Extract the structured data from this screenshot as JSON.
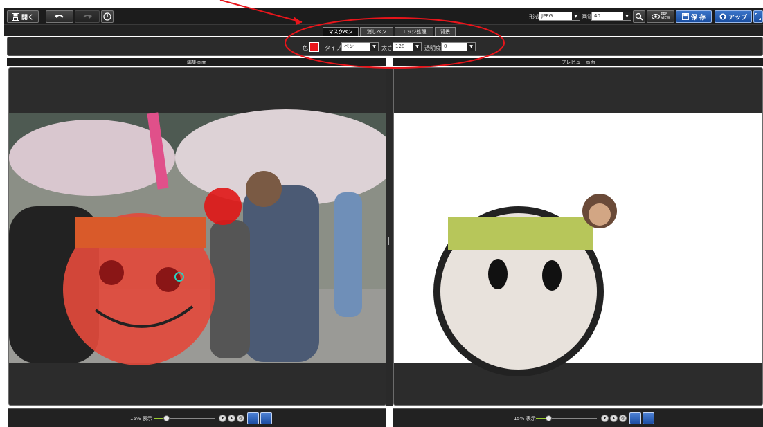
{
  "toolbar": {
    "open_label": "開く",
    "format_label": "形式",
    "format_value": "JPEG",
    "quality_label": "画質",
    "quality_value": "40",
    "preview_label_top": "PRE",
    "preview_label_bottom": "VIEW",
    "save_label": "保 存",
    "upload_label": "アップ"
  },
  "tabs": [
    {
      "label": "マスクペン",
      "active": true
    },
    {
      "label": "消しペン",
      "active": false
    },
    {
      "label": "エッジ処理",
      "active": false
    },
    {
      "label": "背景",
      "active": false
    }
  ],
  "options": {
    "color_label": "色",
    "color_value": "#e8151b",
    "type_label": "タイプ",
    "type_value": "ペン",
    "thickness_label": "太さ",
    "thickness_value": "128",
    "opacity_label": "透明度",
    "opacity_value": "0"
  },
  "panes": {
    "edit_title": "編集画面",
    "preview_title": "プレビュー画面"
  },
  "bottom": {
    "left_zoom_label": "15% 表示",
    "right_zoom_label": "15% 表示",
    "zoom_fraction": 0.2
  },
  "colors": {
    "accent_blue": "#1a4ea0",
    "annotation_red": "#e8151b"
  },
  "icons": [
    "save-icon",
    "undo-icon",
    "redo-icon",
    "power-icon",
    "zoom-icon",
    "preview-icon",
    "upload-icon",
    "zoom-in-icon",
    "zoom-out-icon",
    "reset-icon",
    "fit-icon",
    "move-icon"
  ]
}
